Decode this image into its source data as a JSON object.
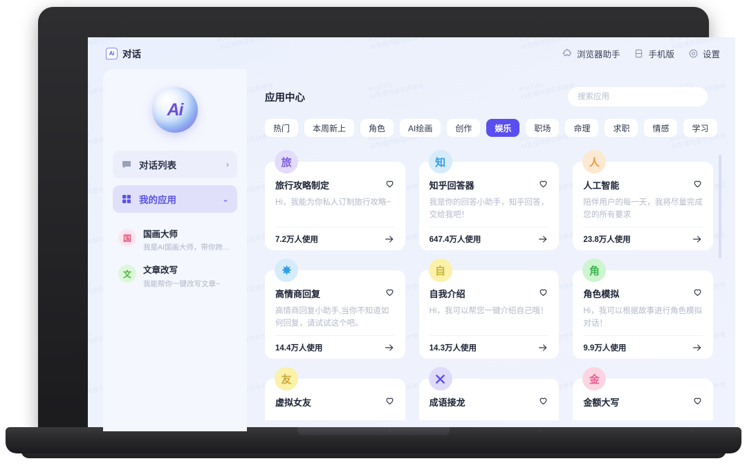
{
  "topbar": {
    "brand_mark": "Ai",
    "brand_text": "对话",
    "items": [
      {
        "label": "浏览器助手",
        "icon": "puzzle-icon"
      },
      {
        "label": "手机版",
        "icon": "mobile-icon"
      },
      {
        "label": "设置",
        "icon": "gear-icon"
      }
    ]
  },
  "sidebar": {
    "logo_text": "Ai",
    "nav": [
      {
        "label": "对话列表",
        "icon": "chat-icon",
        "chevron": "›",
        "active": false
      },
      {
        "label": "我的应用",
        "icon": "grid-icon",
        "chevron": "⌄",
        "active": true
      }
    ],
    "apps": [
      {
        "avatar": "国",
        "name": "国画大师",
        "desc": "我是AI国画大师，带你跨时代体...",
        "color": "#fde7ef",
        "text_color": "#e5537f"
      },
      {
        "avatar": "文",
        "name": "文章改写",
        "desc": "我能帮你一键改写文章~",
        "color": "#ddf7d9",
        "text_color": "#4cb341"
      }
    ]
  },
  "main": {
    "title": "应用中心",
    "search": {
      "value": "",
      "placeholder": "搜索应用"
    },
    "tabs": [
      {
        "label": "热门",
        "active": false
      },
      {
        "label": "本周新上",
        "active": false
      },
      {
        "label": "角色",
        "active": false
      },
      {
        "label": "AI绘画",
        "active": false
      },
      {
        "label": "创作",
        "active": false
      },
      {
        "label": "娱乐",
        "active": true
      },
      {
        "label": "职场",
        "active": false
      },
      {
        "label": "命理",
        "active": false
      },
      {
        "label": "求职",
        "active": false
      },
      {
        "label": "情感",
        "active": false
      },
      {
        "label": "学习",
        "active": false
      }
    ],
    "cards": [
      {
        "badge": "旅",
        "badge_bg": "#e4dcfb",
        "badge_fg": "#7c5be2",
        "title": "旅行攻略制定",
        "desc": "Hi，我能为你私人订制旅行攻略~",
        "uses": "7.2万人使用"
      },
      {
        "badge": "知",
        "badge_bg": "#d7ecfb",
        "badge_fg": "#2f9fe8",
        "title": "知乎回答器",
        "desc": "我是你的回答小助手，知乎回答，交给我吧！",
        "uses": "647.4万人使用"
      },
      {
        "badge": "人",
        "badge_bg": "#fde9d2",
        "badge_fg": "#f2973c",
        "title": "人工智能",
        "desc": "陪伴用户的每一天，我将尽量完成您的所有要求",
        "uses": "23.8万人使用"
      },
      {
        "badge": "sparkle-icon",
        "badge_bg": "#d7ecfb",
        "badge_fg": "#2f9fe8",
        "title": "高情商回复",
        "desc": "高情商回复小助手,当你不知道如何回复，请试试这个吧。",
        "uses": "14.4万人使用"
      },
      {
        "badge": "自",
        "badge_bg": "#fbf1a8",
        "badge_fg": "#c9b53c",
        "title": "自我介绍",
        "desc": "Hi，我可以帮您一键介绍自己哦！",
        "uses": "14.3万人使用"
      },
      {
        "badge": "角",
        "badge_bg": "#cdf5cf",
        "badge_fg": "#3fb551",
        "title": "角色模拟",
        "desc": "Hi，我可以根据故事进行角色模拟对话！",
        "uses": "9.9万人使用"
      },
      {
        "badge": "友",
        "badge_bg": "#fbf1a8",
        "badge_fg": "#c9a83c",
        "title": "虚拟女友",
        "desc": "",
        "uses": ""
      },
      {
        "badge": "cross-icon",
        "badge_bg": "#dedcfa",
        "badge_fg": "#5b4ef0",
        "title": "成语接龙",
        "desc": "",
        "uses": ""
      },
      {
        "badge": "金",
        "badge_bg": "#fbd6e2",
        "badge_fg": "#ec5f91",
        "title": "金额大写",
        "desc": "",
        "uses": ""
      }
    ]
  },
  "watermark": {
    "line1": "iKxxTZG",
    "line2": "AI生成内容仅供参考"
  }
}
